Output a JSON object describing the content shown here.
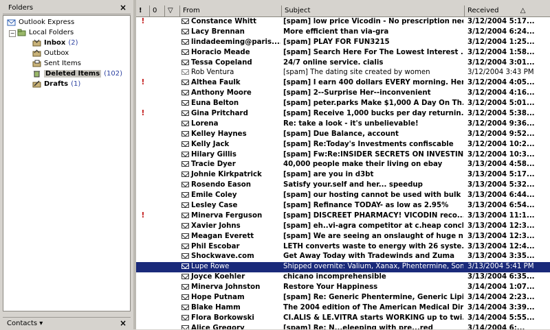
{
  "folders_pane": {
    "title": "Folders",
    "close": "×",
    "items": [
      {
        "label": "Outlook Express",
        "count": "",
        "icon": "outlook-express-icon"
      },
      {
        "label": "Local Folders",
        "count": "",
        "icon": "local-folders-icon"
      },
      {
        "label": "Inbox",
        "count": "(2)",
        "icon": "inbox-icon"
      },
      {
        "label": "Outbox",
        "count": "",
        "icon": "outbox-icon"
      },
      {
        "label": "Sent Items",
        "count": "",
        "icon": "sent-items-icon"
      },
      {
        "label": "Deleted Items",
        "count": "(102)",
        "icon": "deleted-items-icon"
      },
      {
        "label": "Drafts",
        "count": "(1)",
        "icon": "drafts-icon"
      }
    ]
  },
  "contacts_bar": {
    "title": "Contacts ▾",
    "close": "×"
  },
  "list_header": {
    "priority": "!",
    "attachment": "0",
    "flag": "▽",
    "from": "From",
    "subject": "Subject",
    "received": "Received",
    "sort_indicator": "△"
  },
  "messages": [
    {
      "priority": "!",
      "from": "Constance Whitt",
      "subject": "[spam] low price Vicodin - No prescription nee...",
      "received": "3/12/2004 5:17...",
      "read": false
    },
    {
      "priority": "",
      "from": "Lacy Brennan",
      "subject": "More efficient than via-gra",
      "received": "3/12/2004 6:24...",
      "read": false
    },
    {
      "priority": "",
      "from": "lindadeeming@paris....",
      "subject": "[spam] PLAY FOR FUN3215",
      "received": "3/12/2004 1:25...",
      "read": false
    },
    {
      "priority": "",
      "from": "Horacio Meade",
      "subject": "[spam] Search Here For The Lowest Interest ...",
      "received": "3/12/2004 1:58...",
      "read": false
    },
    {
      "priority": "",
      "from": "Tessa Copeland",
      "subject": "24/7 online service. cialis",
      "received": "3/12/2004 3:01...",
      "read": false
    },
    {
      "priority": "",
      "from": "Rob Ventura",
      "subject": "[spam] The dating site created by women",
      "received": "3/12/2004 3:43 PM",
      "read": true
    },
    {
      "priority": "!",
      "from": "Althea Faulk",
      "subject": "[spam] I earn 400 dollars EVERY morning. Her...",
      "received": "3/12/2004 4:05...",
      "read": false
    },
    {
      "priority": "",
      "from": "Anthony Moore",
      "subject": "[spam] 2--Surprise Her--inconvenient",
      "received": "3/12/2004 4:16...",
      "read": false
    },
    {
      "priority": "",
      "from": "Euna Belton",
      "subject": "[spam] peter.parks Make $1,000 A Day On Th...",
      "received": "3/12/2004 5:01...",
      "read": false
    },
    {
      "priority": "!",
      "from": "Gina Pritchard",
      "subject": "[spam] Receive 1,000 bucks per day returnin...",
      "received": "3/12/2004 5:38...",
      "read": false
    },
    {
      "priority": "",
      "from": "Lorena",
      "subject": "Re: take a look - it's unbelievable!",
      "received": "3/12/2004 9:36...",
      "read": false
    },
    {
      "priority": "",
      "from": "Kelley Haynes",
      "subject": "[spam] Due Balance, account",
      "received": "3/12/2004 9:52...",
      "read": false
    },
    {
      "priority": "",
      "from": "Kelly Jack",
      "subject": "[spam] Re:Today's Investments confiscable",
      "received": "3/12/2004 10:2...",
      "read": false
    },
    {
      "priority": "",
      "from": "Hilary Gillis",
      "subject": "[spam] Fw:Re:INSIDER SECRETS ON INVESTING...",
      "received": "3/12/2004 10:3...",
      "read": false
    },
    {
      "priority": "",
      "from": "Tracie Dyer",
      "subject": "40,000 people make their living on ebay",
      "received": "3/13/2004 4:58...",
      "read": false
    },
    {
      "priority": "",
      "from": "Johnie Kirkpatrick",
      "subject": "[spam] are you in d3bt",
      "received": "3/13/2004 5:17...",
      "read": false
    },
    {
      "priority": "",
      "from": "Rosendo Eason",
      "subject": "Satisfy your.self and her... speedup",
      "received": "3/13/2004 5:32...",
      "read": false
    },
    {
      "priority": "",
      "from": "Emile Coley",
      "subject": "[spam] our hosting cannot be used with bulk ...",
      "received": "3/13/2004 6:44...",
      "read": false
    },
    {
      "priority": "",
      "from": "Lesley Case",
      "subject": "[spam] Refinance TODAY- as low as 2.95%",
      "received": "3/13/2004 6:54...",
      "read": false
    },
    {
      "priority": "!",
      "from": "Minerva Ferguson",
      "subject": "[spam] DISCREET PHARMACY! VICODIN   reco...",
      "received": "3/13/2004 11:1...",
      "read": false
    },
    {
      "priority": "",
      "from": "Xavier Johns",
      "subject": "[spam] eh..vi-agra competitor at c.heap concl...",
      "received": "3/13/2004 12:3...",
      "read": false
    },
    {
      "priority": "",
      "from": "Meagan Everett",
      "subject": "[spam] We are seeing an onslaught of huge n...",
      "received": "3/13/2004 12:3...",
      "read": false
    },
    {
      "priority": "",
      "from": "Phil Escobar",
      "subject": "LETH converts waste to energy with 26 syste...",
      "received": "3/13/2004 12:4...",
      "read": false
    },
    {
      "priority": "",
      "from": "Shockwave.com",
      "subject": "Get Away Today with Tradewinds and Zuma",
      "received": "3/13/2004 3:35...",
      "read": false
    },
    {
      "priority": "",
      "from": "Lupe Rowe",
      "subject": "Shipped overnite: Valium, Xanax, Phentermine, Soma...",
      "received": "3/13/2004 5:41 PM",
      "read": true,
      "selected": true
    },
    {
      "priority": "",
      "from": "Joyce Koehler",
      "subject": "chicano incomprehensible",
      "received": "3/13/2004 6:35...",
      "read": false
    },
    {
      "priority": "",
      "from": "Minerva Johnston",
      "subject": "Restore Your Happiness",
      "received": "3/14/2004 1:07...",
      "read": false
    },
    {
      "priority": "",
      "from": "Hope Putnam",
      "subject": "[spam] Re: Generic Phentermine,  Generic Lipi...",
      "received": "3/14/2004 2:23...",
      "read": false
    },
    {
      "priority": "",
      "from": "Blake Hamm",
      "subject": "The 2004 edition of The American Medical Dir...",
      "received": "3/14/2004 3:39...",
      "read": false
    },
    {
      "priority": "",
      "from": "Flora Borkowski",
      "subject": "CI.ALIS & LE.VITRA starts WORKING up to twi...",
      "received": "3/14/2004 5:55...",
      "read": false
    },
    {
      "priority": "",
      "from": "Alice Gregory",
      "subject": "[spam] Re: N...eleeping with pre...red",
      "received": "3/14/2004 6:...",
      "read": false
    }
  ],
  "colors": {
    "selection": "#1a2a7a",
    "priority": "#c01010",
    "count": "#2a3fa0"
  }
}
